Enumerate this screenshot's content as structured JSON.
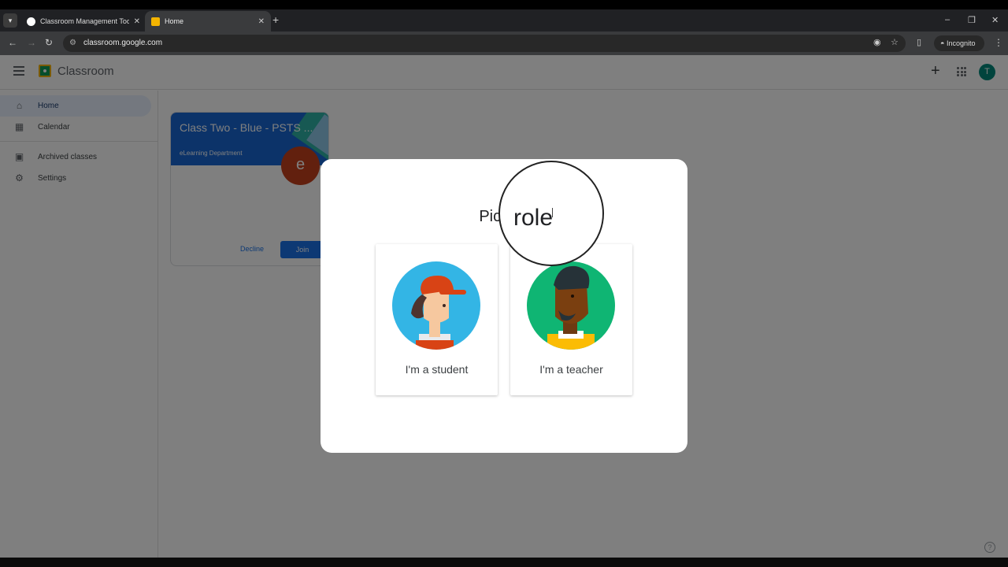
{
  "browser": {
    "tabs": [
      {
        "title": "Classroom Management Tools",
        "active": false
      },
      {
        "title": "Home",
        "active": true
      }
    ],
    "url": "classroom.google.com",
    "incognito_label": "Incognito"
  },
  "app": {
    "name": "Classroom",
    "avatar_letter": "T"
  },
  "sidebar": {
    "items": [
      {
        "label": "Home",
        "icon": "home-icon",
        "active": true
      },
      {
        "label": "Calendar",
        "icon": "calendar-icon",
        "active": false
      },
      {
        "label": "Archived classes",
        "icon": "archive-icon",
        "active": false
      },
      {
        "label": "Settings",
        "icon": "gear-icon",
        "active": false
      }
    ]
  },
  "class_card": {
    "title": "Class Two - Blue - PSTS ...",
    "subtitle": "eLearning Department",
    "avatar_letter": "e",
    "decline_label": "Decline",
    "join_label": "Join"
  },
  "dialog": {
    "title": "Pick yc",
    "magnified_text": "role",
    "roles": [
      {
        "label": "I'm a student",
        "icon": "student-illustration"
      },
      {
        "label": "I'm a teacher",
        "icon": "teacher-illustration"
      }
    ]
  },
  "colors": {
    "brand_blue": "#1a73e8",
    "card_header": "#1967d2",
    "avatar": "#00897b",
    "card_avatar": "#c5401d"
  }
}
